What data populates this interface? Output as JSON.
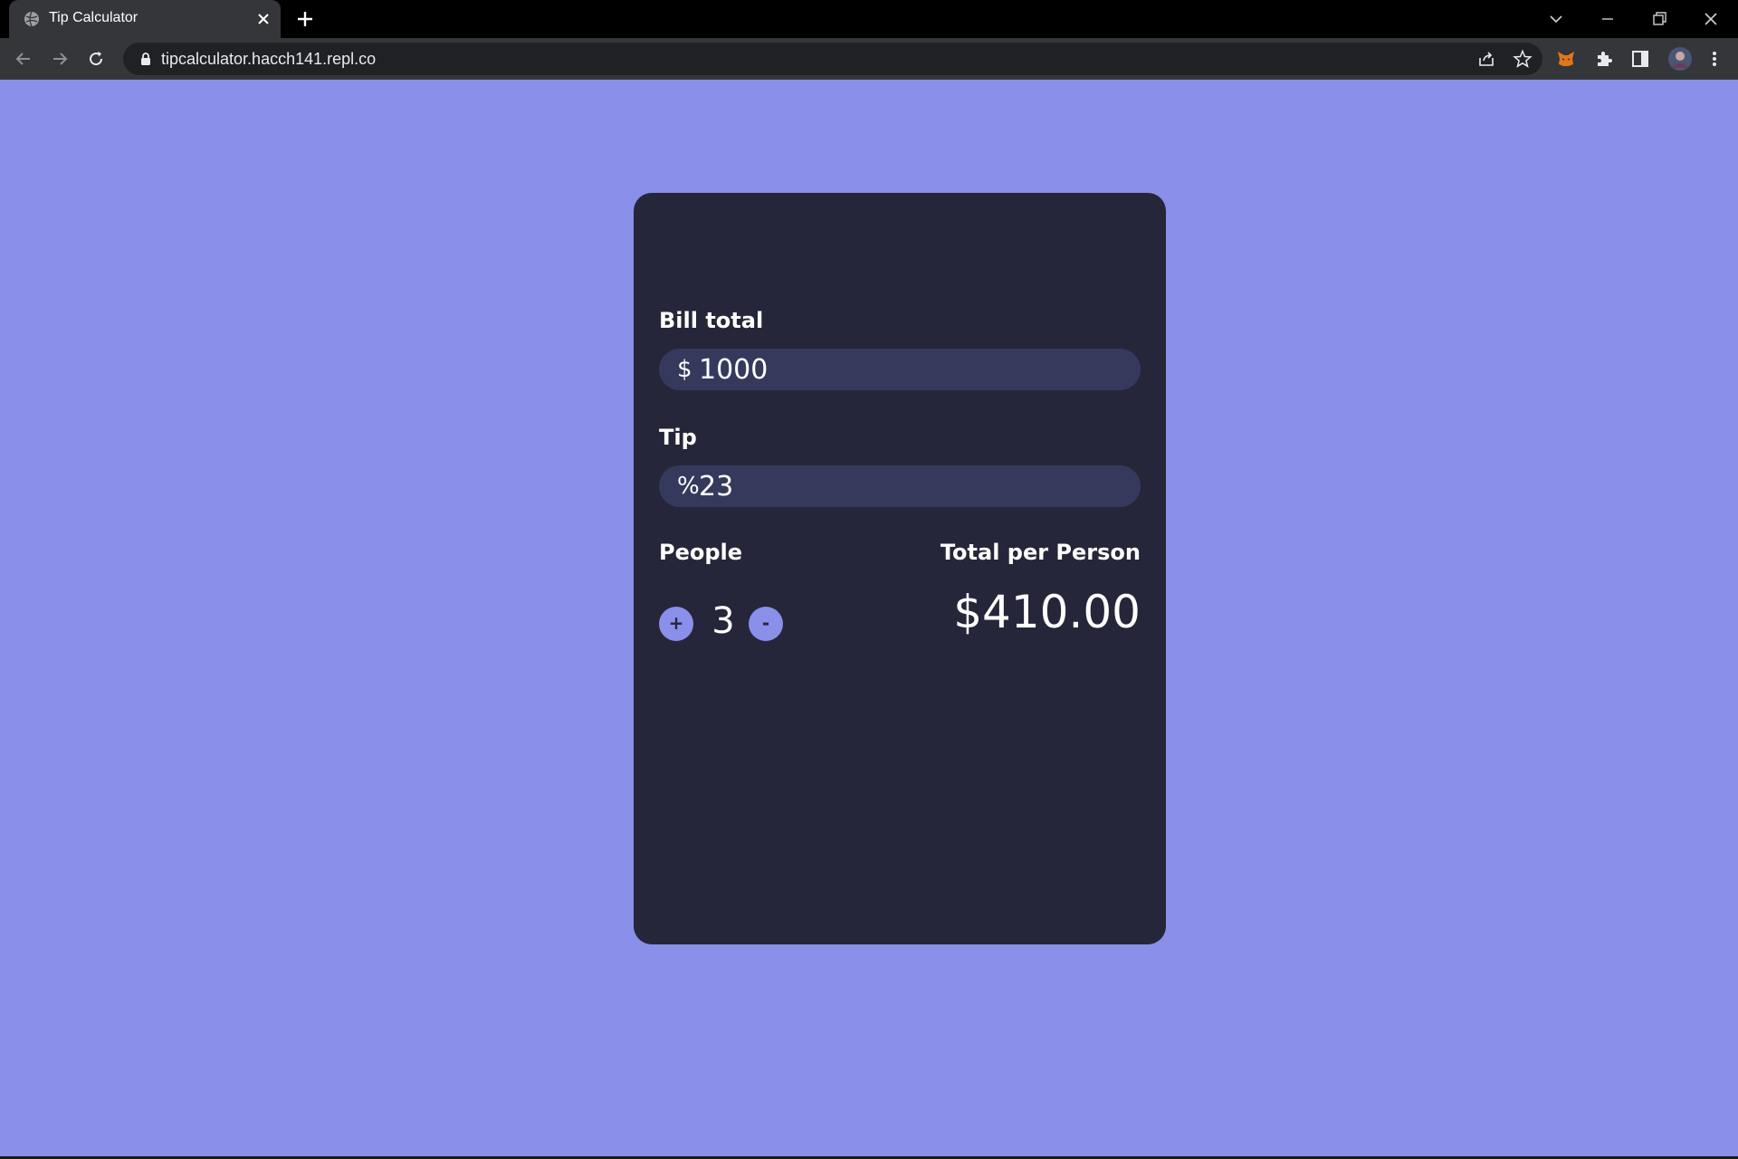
{
  "browser": {
    "tab_title": "Tip Calculator",
    "url": "tipcalculator.hacch141.repl.co"
  },
  "calculator": {
    "bill_label": "Bill total",
    "bill_prefix": "$",
    "bill_value": "1000",
    "tip_label": "Tip",
    "tip_prefix": "%",
    "tip_value": "23",
    "people_label": "People",
    "people_count": "3",
    "plus_label": "+",
    "minus_label": "-",
    "total_label": "Total per Person",
    "total_value": "$410.00"
  },
  "colors": {
    "page_background": "#8a8fea",
    "card_background": "#26263a",
    "field_background": "#353a5d",
    "accent": "#8a8fea"
  }
}
